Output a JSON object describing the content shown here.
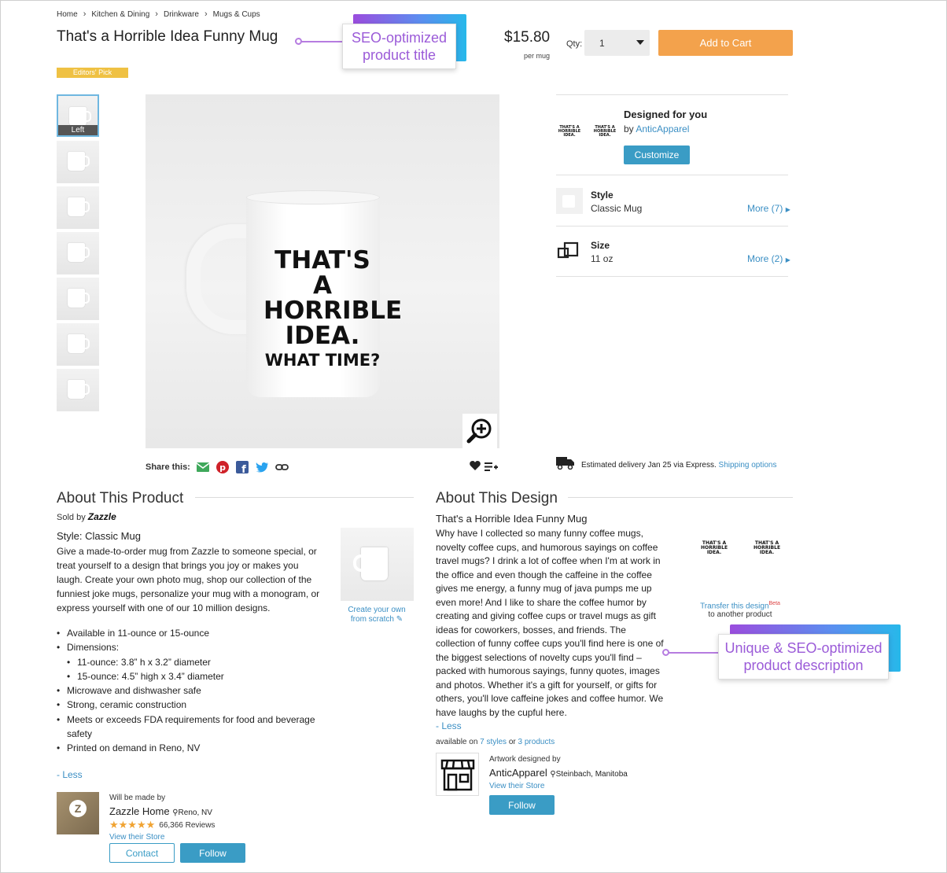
{
  "breadcrumb": [
    "Home",
    "Kitchen & Dining",
    "Drinkware",
    "Mugs & Cups"
  ],
  "product": {
    "title": "That's a Horrible Idea Funny Mug",
    "badge": "Editors' Pick",
    "price": "$15.80",
    "per_unit": "per mug",
    "qty_label": "Qty:",
    "qty_value": "1",
    "add_to_cart": "Add to Cart"
  },
  "callouts": {
    "title_callout": "SEO-optimized product title",
    "desc_callout": "Unique & SEO-optimized product description"
  },
  "thumbnails": {
    "selected_label": "Left",
    "count": 7
  },
  "mug_print": {
    "line1": "THAT'S A",
    "line2": "HORRIBLE",
    "line3": "IDEA.",
    "line4": "WHAT TIME?"
  },
  "share": {
    "label": "Share this:",
    "icons": [
      "email-icon",
      "pinterest-icon",
      "facebook-icon",
      "twitter-icon",
      "link-icon"
    ]
  },
  "designed_for_you": {
    "title": "Designed for you",
    "by": "by",
    "designer": "AnticApparel",
    "customize": "Customize"
  },
  "options": {
    "style_title": "Style",
    "style_value": "Classic Mug",
    "style_more": "More (7)",
    "size_title": "Size",
    "size_value": "11 oz",
    "size_more": "More (2)"
  },
  "delivery": {
    "text": "Estimated delivery Jan 25 via Express.",
    "link": "Shipping options"
  },
  "about_product": {
    "heading": "About This Product",
    "sold_by": "Sold by",
    "seller": "Zazzle",
    "style_line": "Style: Classic Mug",
    "description": "Give a made-to-order mug from Zazzle to someone special, or treat yourself to a design that brings you joy or makes you laugh. Create your own photo mug, shop our collection of the funniest joke mugs, personalize your mug with a monogram, or express yourself with one of our 10 million designs.",
    "bullets": [
      {
        "text": "Available in 11-ounce or 15-ounce",
        "sub": false
      },
      {
        "text": "Dimensions:",
        "sub": false
      },
      {
        "text": "11-ounce: 3.8” h x 3.2” diameter",
        "sub": true
      },
      {
        "text": "15-ounce: 4.5” high x 3.4” diameter",
        "sub": true
      },
      {
        "text": "Microwave and dishwasher safe",
        "sub": false
      },
      {
        "text": "Strong, ceramic construction",
        "sub": false
      },
      {
        "text": "Meets or exceeds FDA requirements for food and beverage safety",
        "sub": false
      },
      {
        "text": "Printed on demand in Reno, NV",
        "sub": false
      }
    ],
    "less": "- Less",
    "create_own": "Create your own from scratch",
    "made_by_label": "Will be made by",
    "maker_name": "Zazzle Home",
    "maker_location": "Reno, NV",
    "reviews": "66,366 Reviews",
    "rating": 5,
    "view_store": "View their Store",
    "contact": "Contact",
    "follow": "Follow"
  },
  "about_design": {
    "heading": "About This Design",
    "title": "That's a Horrible Idea Funny Mug",
    "description": "Why have I collected so many funny coffee mugs, novelty coffee cups, and humorous sayings on coffee travel mugs? I drink a lot of coffee when I'm at work in the office and even though the caffeine in the coffee gives me energy, a funny mug of java pumps me up even more! And I like to share the coffee humor by creating and giving coffee cups or travel mugs as gift ideas for coworkers, bosses, and friends. The collection of funny coffee cups you'll find here is one of the biggest selections of novelty cups you'll find – packed with humorous sayings, funny quotes, images and photos. Whether it's a gift for yourself, or gifts for others, you'll love caffeine jokes and coffee humor. We have laughs by the cupful here.",
    "less": "- Less",
    "available_on": "available on",
    "styles_link": "7 styles",
    "or": "or",
    "products_link": "3 products",
    "transfer": "Transfer this design",
    "beta": "Beta",
    "transfer_sub": "to another product",
    "artwork_label": "Artwork designed by",
    "artist": "AnticApparel",
    "artist_location": "Steinbach, Manitoba",
    "view_store": "View their Store",
    "follow": "Follow"
  },
  "colors": {
    "accent": "#3a9cc5",
    "cart": "#f3a24c",
    "badge": "#efc143",
    "callout_text": "#9b5bd8"
  }
}
